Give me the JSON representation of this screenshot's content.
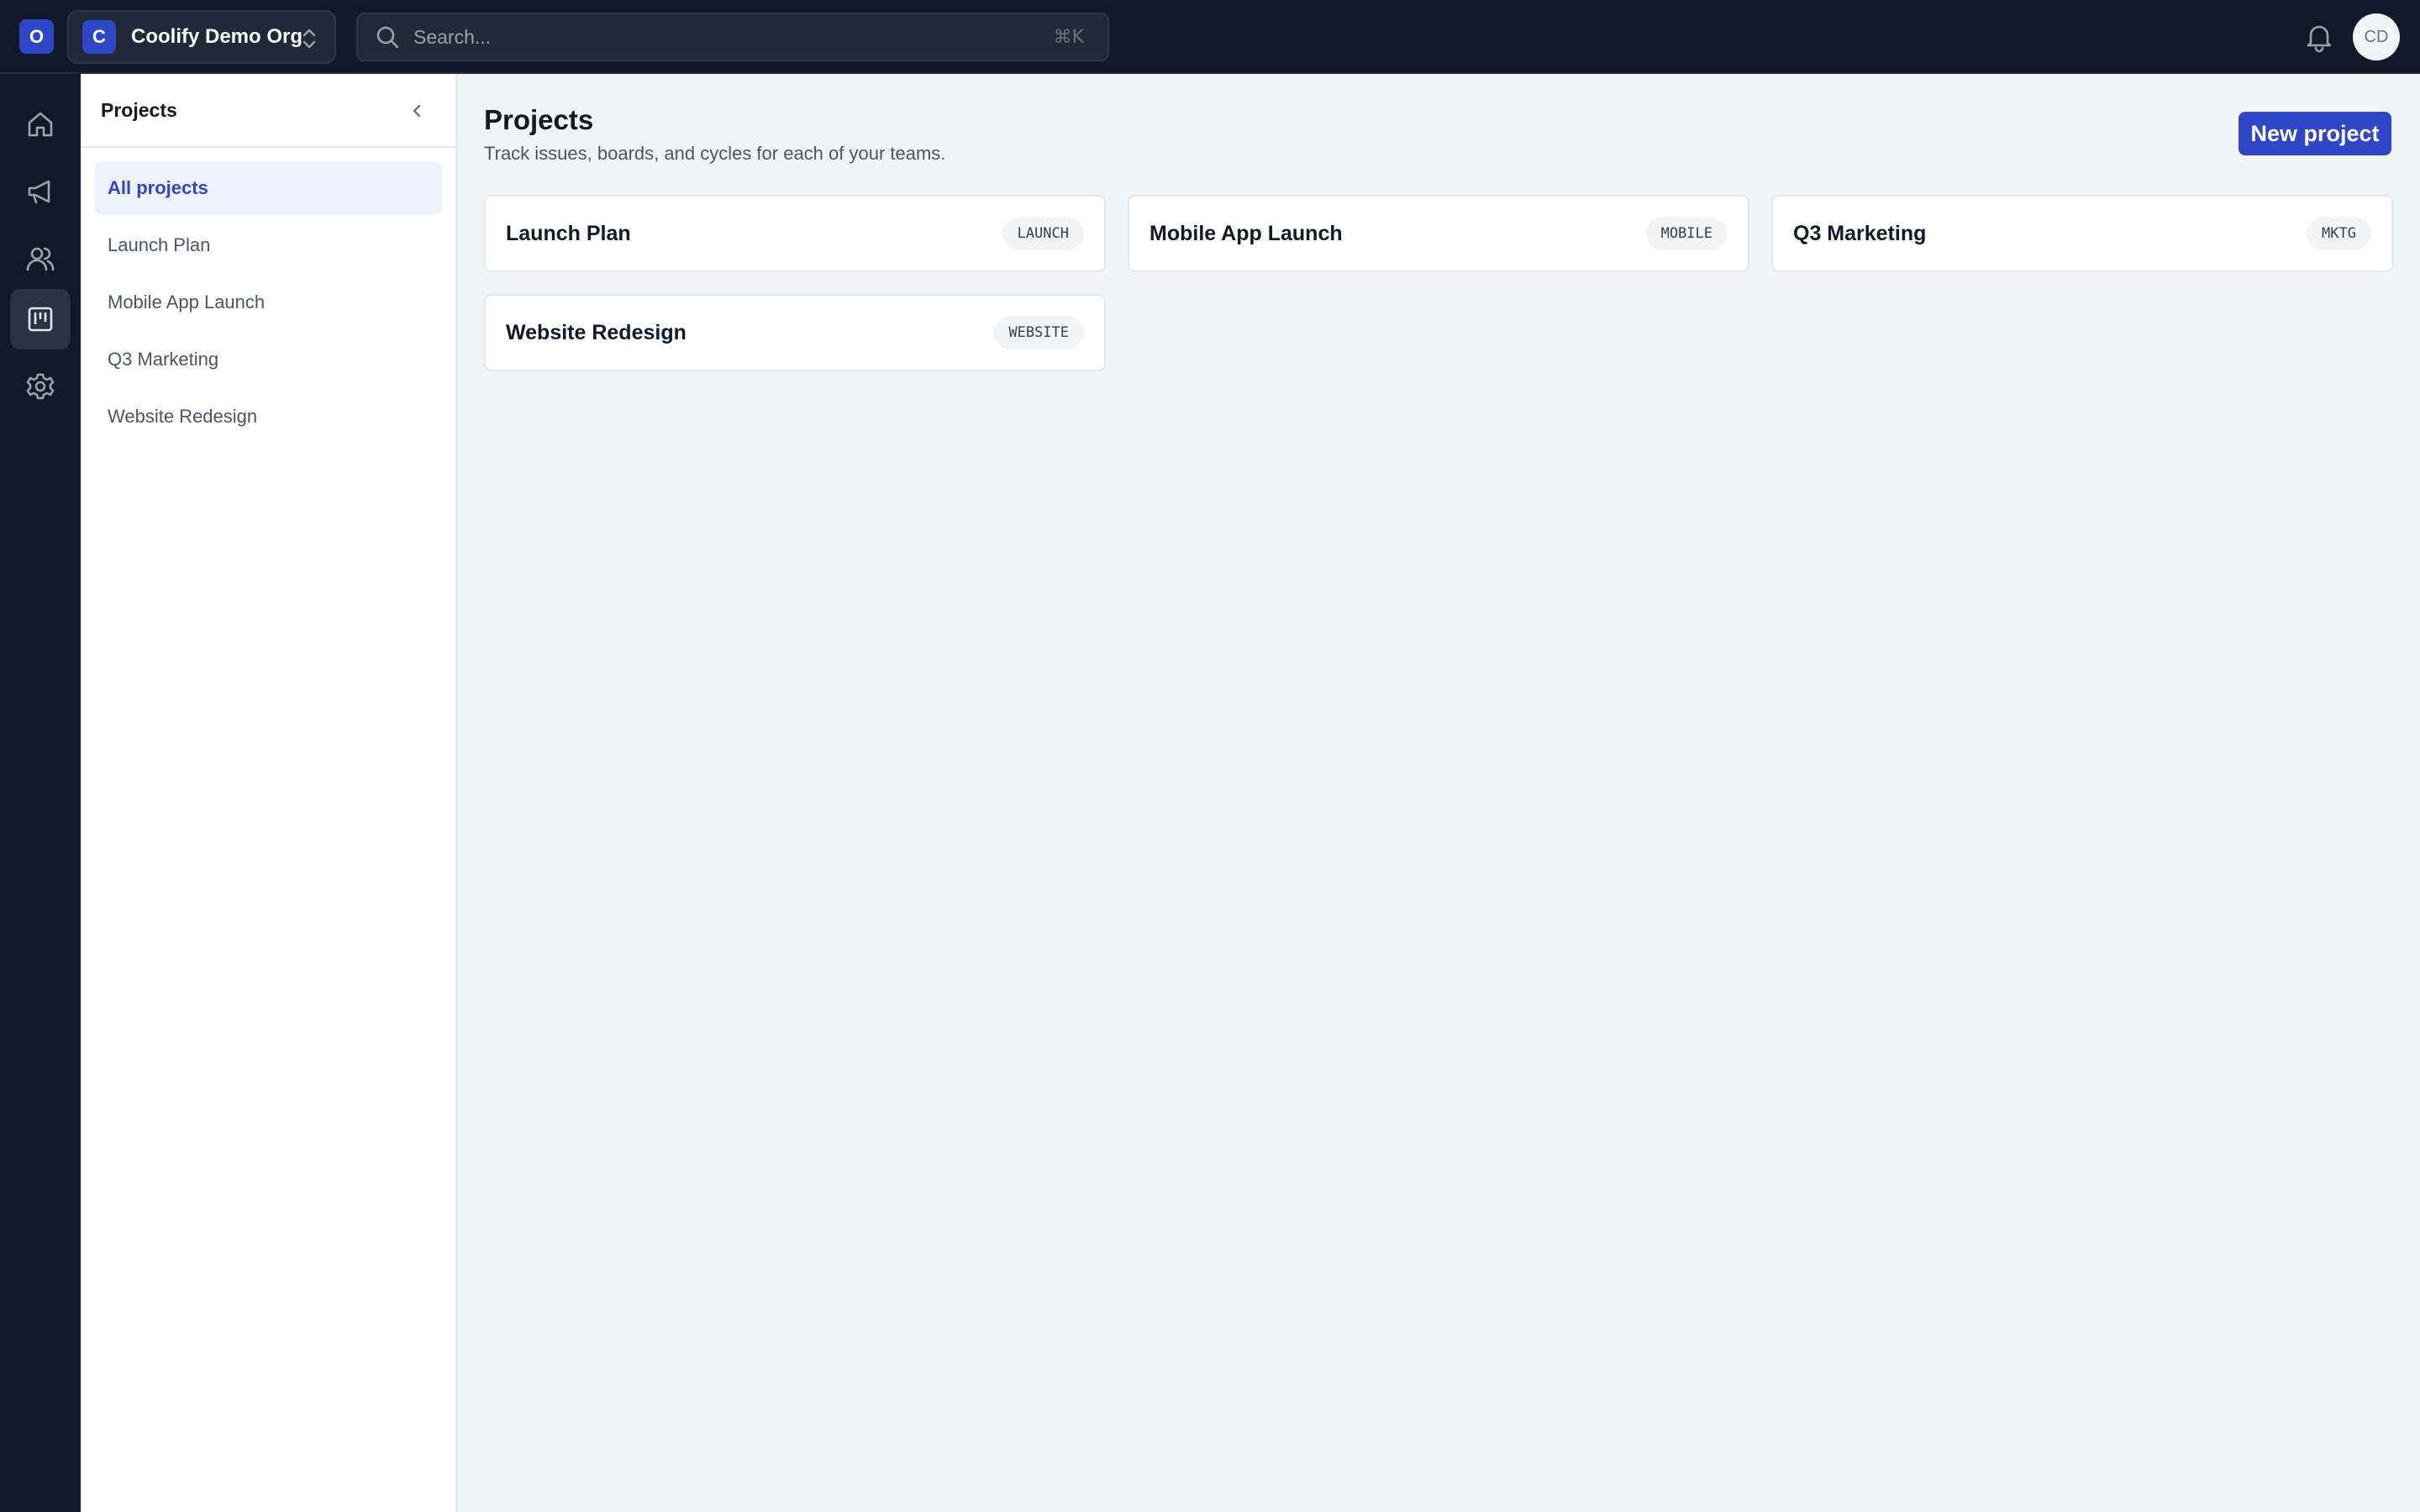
{
  "topbar": {
    "org_badge": "O",
    "org_initial": "C",
    "org_name": "Coolify Demo Org",
    "search_placeholder": "Search...",
    "search_shortcut": "⌘K",
    "user_initials": "CD"
  },
  "rail": {
    "items": [
      {
        "icon": "home-icon"
      },
      {
        "icon": "megaphone-icon"
      },
      {
        "icon": "users-icon"
      },
      {
        "icon": "board-icon",
        "active": true
      },
      {
        "icon": "gear-icon"
      }
    ]
  },
  "sidebar": {
    "title": "Projects",
    "items": [
      {
        "label": "All projects",
        "active": true
      },
      {
        "label": "Launch Plan"
      },
      {
        "label": "Mobile App Launch"
      },
      {
        "label": "Q3 Marketing"
      },
      {
        "label": "Website Redesign"
      }
    ]
  },
  "main": {
    "title": "Projects",
    "subtitle": "Track issues, boards, and cycles for each of your teams.",
    "new_button": "New project",
    "projects": [
      {
        "name": "Launch Plan",
        "key": "LAUNCH"
      },
      {
        "name": "Mobile App Launch",
        "key": "MOBILE"
      },
      {
        "name": "Q3 Marketing",
        "key": "MKTG"
      },
      {
        "name": "Website Redesign",
        "key": "WEBSITE"
      }
    ]
  },
  "colors": {
    "accent": "#2f46c6",
    "topbar_bg": "#111827",
    "page_bg": "#f3f4f6"
  }
}
